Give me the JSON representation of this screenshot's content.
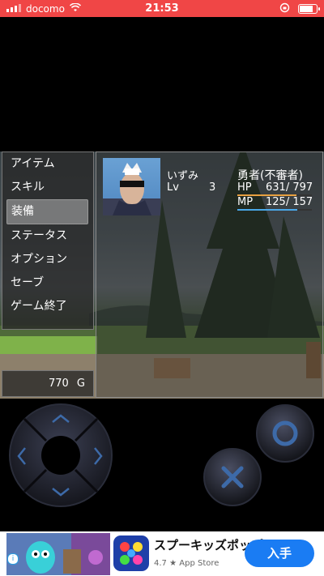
{
  "status_bar": {
    "carrier": "docomo",
    "time": "21:53"
  },
  "menu": {
    "items": [
      "アイテム",
      "スキル",
      "装備",
      "ステータス",
      "オプション",
      "セーブ",
      "ゲーム終了"
    ],
    "selected_index": 2
  },
  "gold": {
    "amount": "770",
    "unit": "G"
  },
  "actor": {
    "name": "いずみ",
    "level_label": "Lv",
    "level": "3",
    "class": "勇者(不審者)",
    "hp_label": "HP",
    "hp": "631/ 797",
    "mp_label": "MP",
    "mp": "125/ 157",
    "hp_ratio": 0.79,
    "mp_ratio": 0.8
  },
  "colors": {
    "hp_bar": "#e8a040",
    "mp_bar": "#4aa8e8",
    "status_bar": "#f04646",
    "ad_button": "#1a7cf3"
  },
  "ad": {
    "title": "スプーキッズポップ",
    "rating": "4.7",
    "store": "App Store",
    "button": "入手"
  }
}
